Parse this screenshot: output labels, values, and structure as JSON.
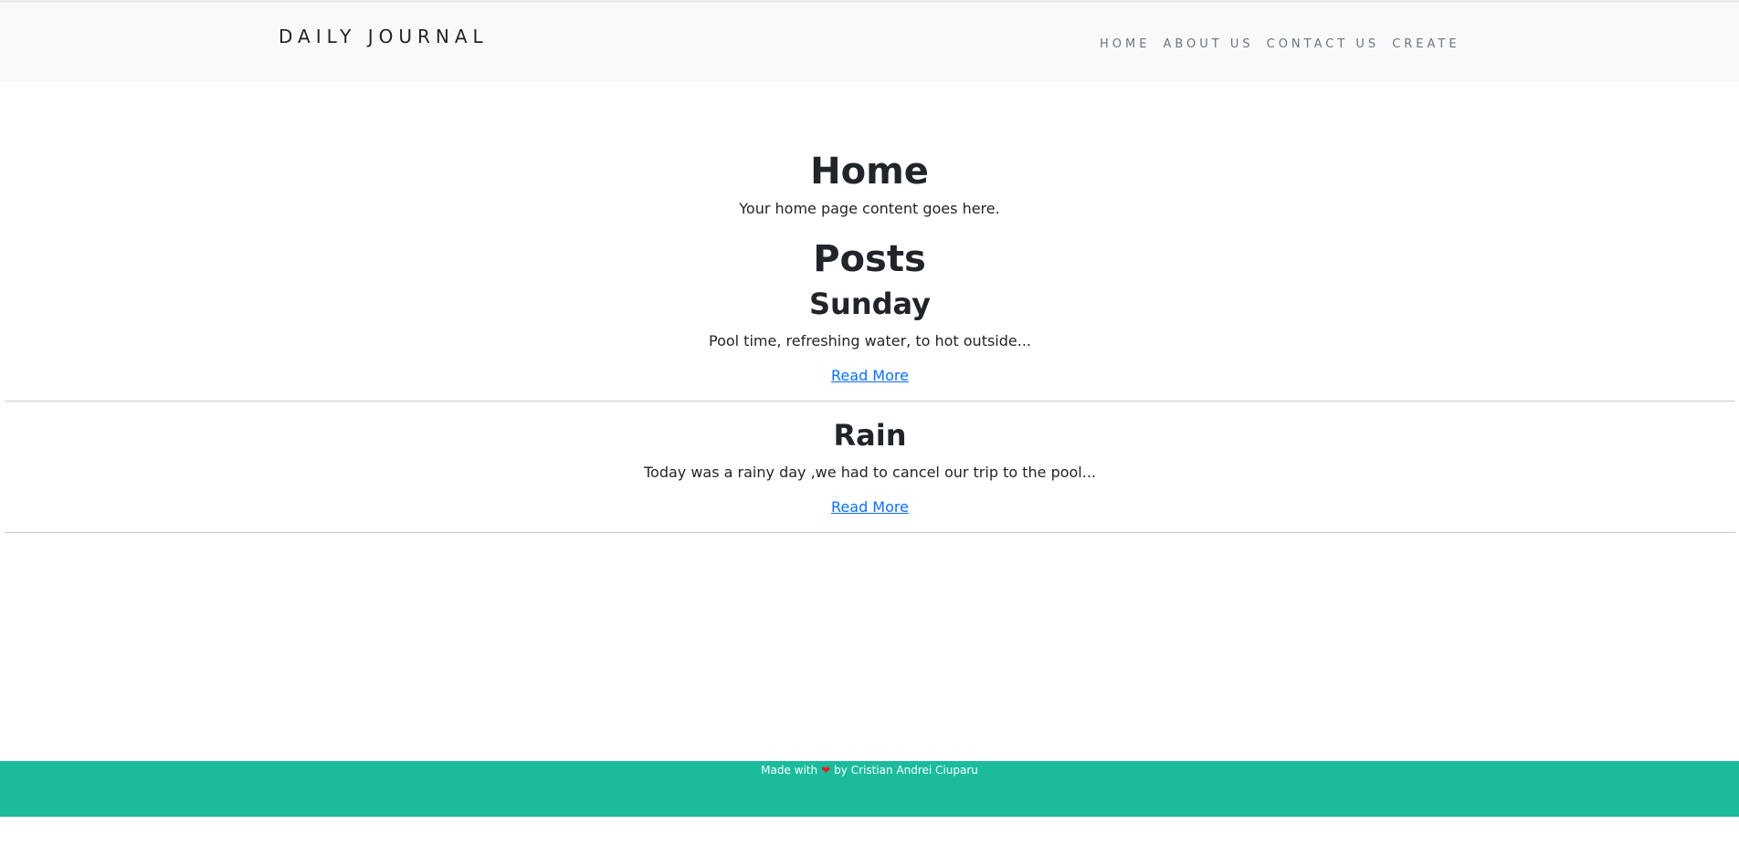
{
  "navbar": {
    "brand": "DAILY JOURNAL",
    "links": [
      "HOME",
      "ABOUT US",
      "CONTACT US",
      "CREATE"
    ]
  },
  "main": {
    "home_heading": "Home",
    "home_text": "Your home page content goes here.",
    "posts_heading": "Posts",
    "posts": [
      {
        "title": "Sunday",
        "excerpt": "Pool time, refreshing water, to hot outside...",
        "link": "Read More"
      },
      {
        "title": "Rain",
        "excerpt": "Today was a rainy day ,we had to cancel our trip to the pool...",
        "link": "Read More"
      }
    ]
  },
  "footer": {
    "prefix": "Made with",
    "icon": "heart-icon",
    "suffix": "by Cristian Andrei Ciuparu"
  },
  "colors": {
    "navbar_bg": "#f8f9fa",
    "footer_bg": "#1abc9c",
    "link": "#0d6efd",
    "heart": "#e02424"
  }
}
